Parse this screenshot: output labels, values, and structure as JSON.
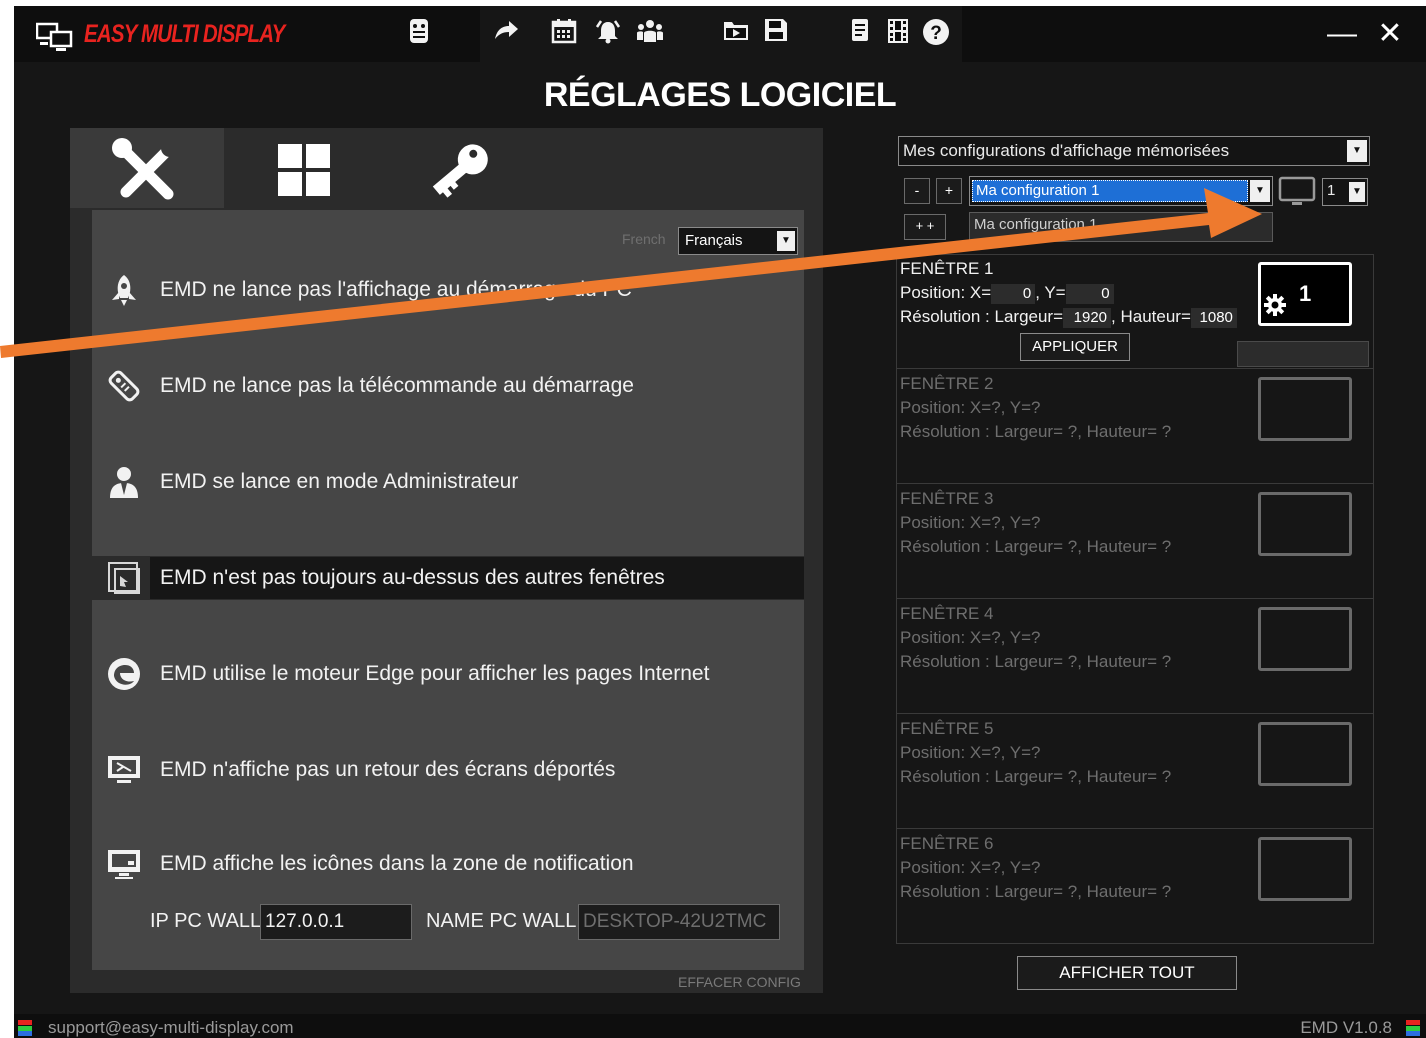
{
  "app": {
    "name": "EASY MULTI DISPLAY",
    "title": "RÉGLAGES LOGICIEL",
    "toolbar_icons": [
      "remote-icon",
      "share-arrow-icon",
      "calendar-icon",
      "alarm-icon",
      "group-icon",
      "folder-play-icon",
      "save-icon",
      "note-icon",
      "film-icon",
      "help-icon"
    ],
    "minimize": "—",
    "close": "✕"
  },
  "left": {
    "tabs": [
      "tools-icon",
      "grid-icon",
      "key-icon"
    ],
    "language_label": "French",
    "language_value": "Français",
    "options": [
      {
        "icon": "rocket-icon",
        "label": "EMD ne lance pas l'affichage au démarrage du PC"
      },
      {
        "icon": "remote-control-icon",
        "label": "EMD ne lance pas la télécommande au démarrage"
      },
      {
        "icon": "admin-user-icon",
        "label": "EMD se lance en mode Administrateur"
      },
      {
        "icon": "window-front-icon",
        "label": "EMD n'est pas toujours au-dessus des autres fenêtres"
      },
      {
        "icon": "edge-icon",
        "label": "EMD utilise le moteur Edge pour afficher les pages Internet"
      },
      {
        "icon": "remote-screen-icon",
        "label": "EMD n'affiche pas un retour des écrans déportés"
      },
      {
        "icon": "monitor-icon",
        "label": "EMD affiche les icônes dans la zone de notification"
      }
    ],
    "ip_label": "IP PC WALL",
    "ip_value": "127.0.0.1",
    "name_label": "NAME PC WALL",
    "name_placeholder": "DESKTOP-42U2TMC",
    "clear_label": "EFFACER CONFIG"
  },
  "right": {
    "saved_configs": "Mes configurations d'affichage mémorisées",
    "minus": "-",
    "plus": "+",
    "plusplus": "+ +",
    "config_selected": "Ma configuration 1",
    "config_name": "Ma configuration 1",
    "screen_num": "1",
    "windows": [
      {
        "title": "FENÊTRE 1",
        "pos_prefix": "Position: X=",
        "x": "0",
        "y_label": ", Y=",
        "y": "0",
        "res_prefix": "Résolution : Largeur=",
        "w": "1920",
        "h_label": ", Hauteur=",
        "h": "1080",
        "apply": "APPLIQUER",
        "screen": "1"
      },
      {
        "title": "FENÊTRE 2",
        "pos": "Position: X=?, Y=?",
        "res": "Résolution : Largeur= ?, Hauteur= ?"
      },
      {
        "title": "FENÊTRE 3",
        "pos": "Position: X=?, Y=?",
        "res": "Résolution : Largeur= ?, Hauteur= ?"
      },
      {
        "title": "FENÊTRE 4",
        "pos": "Position: X=?, Y=?",
        "res": "Résolution : Largeur= ?, Hauteur= ?"
      },
      {
        "title": "FENÊTRE 5",
        "pos": "Position: X=?, Y=?",
        "res": "Résolution : Largeur= ?, Hauteur= ?"
      },
      {
        "title": "FENÊTRE 6",
        "pos": "Position: X=?, Y=?",
        "res": "Résolution : Largeur= ?, Hauteur= ?"
      }
    ],
    "show_all": "AFFICHER TOUT"
  },
  "status": {
    "email": "support@easy-multi-display.com",
    "version": "EMD V1.0.8"
  },
  "colors": {
    "brand": "#e8231f",
    "annotation_arrow": "#ee7a2e",
    "selection": "#1e6fd6"
  }
}
